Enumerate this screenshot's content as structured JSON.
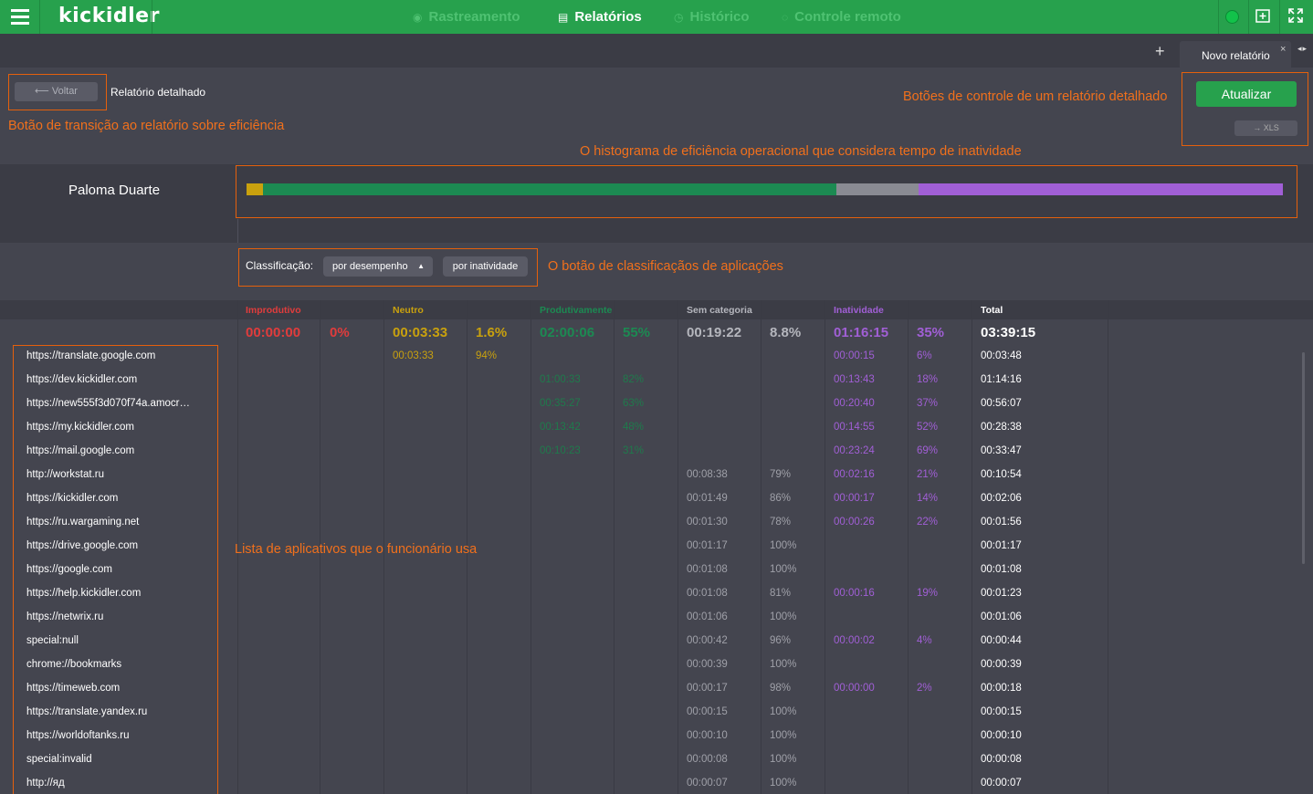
{
  "topbar": {
    "logo": "kickidler",
    "nav": [
      {
        "label": "Rastreamento",
        "icon": "eye-icon"
      },
      {
        "label": "Relatórios",
        "icon": "document-icon"
      },
      {
        "label": "Histórico",
        "icon": "history-icon"
      },
      {
        "label": "Controle remoto",
        "icon": "remote-icon"
      }
    ],
    "active": "Relatórios"
  },
  "tabs": {
    "plus": "+",
    "tab_label": "Novo relatório",
    "close": "×",
    "arrows": "◂▸"
  },
  "header": {
    "back_label": "⟵ Voltar",
    "title": "Relatório detalhado",
    "refresh_label": "Atualizar",
    "xls_label": "→ XLS"
  },
  "annotations": {
    "back": "Botão de transição ao relatório sobre eficiência",
    "controls": "Botões de controle de um relatório detalhado",
    "histogram": "O histograma de eficiência operacional que considera tempo de inatividade",
    "classification": "O botão de classificaçãos de aplicações",
    "list": "Lista de aplicativos que o funcionário usa"
  },
  "employee": {
    "name": "Paloma Duarte",
    "histogram": [
      {
        "category": "Neutro",
        "color": "#c9a10e",
        "fraction": 0.016
      },
      {
        "category": "Produtivamente",
        "color": "#1c8a52",
        "fraction": 0.55
      },
      {
        "category": "Sem categoria",
        "color": "#8a8b93",
        "fraction": 0.079
      },
      {
        "category": "Inatividade",
        "color": "#a15fd6",
        "fraction": 0.35
      }
    ]
  },
  "classification": {
    "label": "Classificação:",
    "by_performance": "por desempenho",
    "by_idle": "por inatividade"
  },
  "columns": {
    "unproductive": {
      "label": "Improdutivo",
      "color": "#e13c3c",
      "total": "00:00:00",
      "pct": "0%"
    },
    "neutral": {
      "label": "Neutro",
      "color": "#c9a10e",
      "total": "00:03:33",
      "pct": "1.6%"
    },
    "productive": {
      "label": "Produtivamente",
      "color": "#1c8a52",
      "total": "02:00:06",
      "pct": "55%"
    },
    "uncategorized": {
      "label": "Sem categoria",
      "color": "#b5b6bd",
      "total": "00:19:22",
      "pct": "8.8%"
    },
    "idle": {
      "label": "Inatividade",
      "color": "#a15fd6",
      "total": "01:16:15",
      "pct": "35%"
    },
    "total": {
      "label": "Total",
      "color": "#ffffff",
      "total": "03:39:15"
    }
  },
  "rows": [
    {
      "app": "https://translate.google.com",
      "neu": "00:03:33",
      "neu_p": "94%",
      "pro": "",
      "pro_p": "",
      "unc": "",
      "unc_p": "",
      "idle": "00:00:15",
      "idle_p": "6%",
      "total": "00:03:48"
    },
    {
      "app": "https://dev.kickidler.com",
      "neu": "",
      "neu_p": "",
      "pro": "01:00:33",
      "pro_p": "82%",
      "unc": "",
      "unc_p": "",
      "idle": "00:13:43",
      "idle_p": "18%",
      "total": "01:14:16"
    },
    {
      "app": "https://new555f3d070f74a.amocr…",
      "neu": "",
      "neu_p": "",
      "pro": "00:35:27",
      "pro_p": "63%",
      "unc": "",
      "unc_p": "",
      "idle": "00:20:40",
      "idle_p": "37%",
      "total": "00:56:07"
    },
    {
      "app": "https://my.kickidler.com",
      "neu": "",
      "neu_p": "",
      "pro": "00:13:42",
      "pro_p": "48%",
      "unc": "",
      "unc_p": "",
      "idle": "00:14:55",
      "idle_p": "52%",
      "total": "00:28:38"
    },
    {
      "app": "https://mail.google.com",
      "neu": "",
      "neu_p": "",
      "pro": "00:10:23",
      "pro_p": "31%",
      "unc": "",
      "unc_p": "",
      "idle": "00:23:24",
      "idle_p": "69%",
      "total": "00:33:47"
    },
    {
      "app": "http://workstat.ru",
      "neu": "",
      "neu_p": "",
      "pro": "",
      "pro_p": "",
      "unc": "00:08:38",
      "unc_p": "79%",
      "idle": "00:02:16",
      "idle_p": "21%",
      "total": "00:10:54"
    },
    {
      "app": "https://kickidler.com",
      "neu": "",
      "neu_p": "",
      "pro": "",
      "pro_p": "",
      "unc": "00:01:49",
      "unc_p": "86%",
      "idle": "00:00:17",
      "idle_p": "14%",
      "total": "00:02:06"
    },
    {
      "app": "https://ru.wargaming.net",
      "neu": "",
      "neu_p": "",
      "pro": "",
      "pro_p": "",
      "unc": "00:01:30",
      "unc_p": "78%",
      "idle": "00:00:26",
      "idle_p": "22%",
      "total": "00:01:56"
    },
    {
      "app": "https://drive.google.com",
      "neu": "",
      "neu_p": "",
      "pro": "",
      "pro_p": "",
      "unc": "00:01:17",
      "unc_p": "100%",
      "idle": "",
      "idle_p": "",
      "total": "00:01:17"
    },
    {
      "app": "https://google.com",
      "neu": "",
      "neu_p": "",
      "pro": "",
      "pro_p": "",
      "unc": "00:01:08",
      "unc_p": "100%",
      "idle": "",
      "idle_p": "",
      "total": "00:01:08"
    },
    {
      "app": "https://help.kickidler.com",
      "neu": "",
      "neu_p": "",
      "pro": "",
      "pro_p": "",
      "unc": "00:01:08",
      "unc_p": "81%",
      "idle": "00:00:16",
      "idle_p": "19%",
      "total": "00:01:23"
    },
    {
      "app": "https://netwrix.ru",
      "neu": "",
      "neu_p": "",
      "pro": "",
      "pro_p": "",
      "unc": "00:01:06",
      "unc_p": "100%",
      "idle": "",
      "idle_p": "",
      "total": "00:01:06"
    },
    {
      "app": "special:null",
      "neu": "",
      "neu_p": "",
      "pro": "",
      "pro_p": "",
      "unc": "00:00:42",
      "unc_p": "96%",
      "idle": "00:00:02",
      "idle_p": "4%",
      "total": "00:00:44"
    },
    {
      "app": "chrome://bookmarks",
      "neu": "",
      "neu_p": "",
      "pro": "",
      "pro_p": "",
      "unc": "00:00:39",
      "unc_p": "100%",
      "idle": "",
      "idle_p": "",
      "total": "00:00:39"
    },
    {
      "app": "https://timeweb.com",
      "neu": "",
      "neu_p": "",
      "pro": "",
      "pro_p": "",
      "unc": "00:00:17",
      "unc_p": "98%",
      "idle": "00:00:00",
      "idle_p": "2%",
      "total": "00:00:18"
    },
    {
      "app": "https://translate.yandex.ru",
      "neu": "",
      "neu_p": "",
      "pro": "",
      "pro_p": "",
      "unc": "00:00:15",
      "unc_p": "100%",
      "idle": "",
      "idle_p": "",
      "total": "00:00:15"
    },
    {
      "app": "https://worldoftanks.ru",
      "neu": "",
      "neu_p": "",
      "pro": "",
      "pro_p": "",
      "unc": "00:00:10",
      "unc_p": "100%",
      "idle": "",
      "idle_p": "",
      "total": "00:00:10"
    },
    {
      "app": "special:invalid",
      "neu": "",
      "neu_p": "",
      "pro": "",
      "pro_p": "",
      "unc": "00:00:08",
      "unc_p": "100%",
      "idle": "",
      "idle_p": "",
      "total": "00:00:08"
    },
    {
      "app": "http://яд",
      "neu": "",
      "neu_p": "",
      "pro": "",
      "pro_p": "",
      "unc": "00:00:07",
      "unc_p": "100%",
      "idle": "",
      "idle_p": "",
      "total": "00:00:07"
    }
  ]
}
